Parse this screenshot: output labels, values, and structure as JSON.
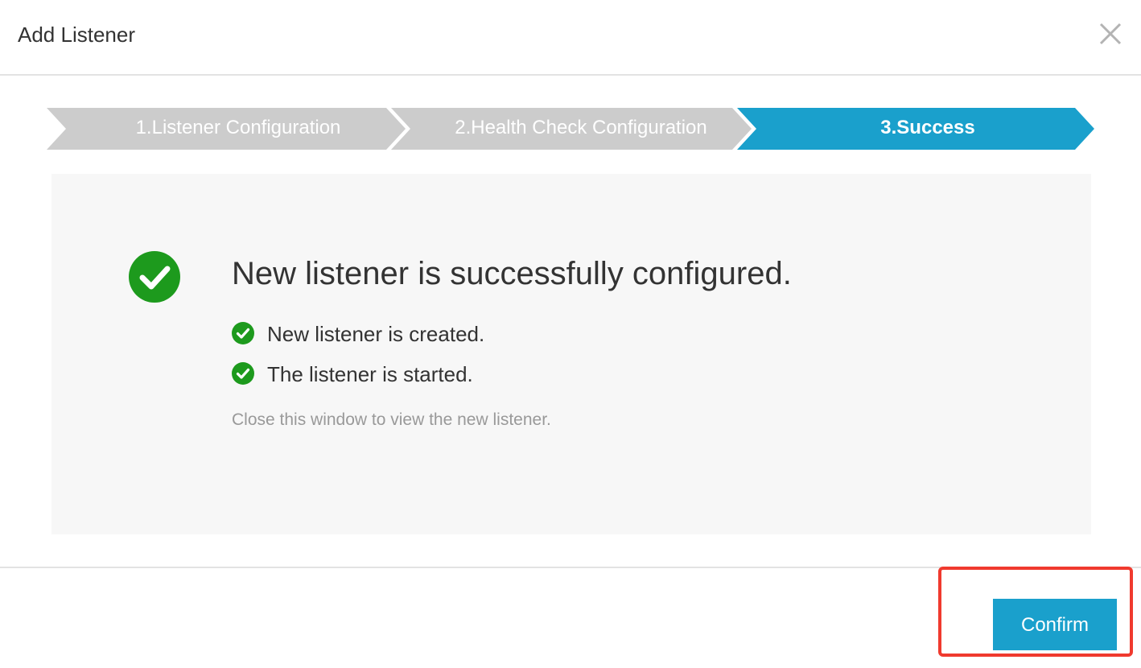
{
  "dialog": {
    "title": "Add Listener",
    "close_icon": "close-icon"
  },
  "steps": [
    {
      "label": "1.Listener Configuration",
      "state": "done",
      "color": "#cccccc"
    },
    {
      "label": "2.Health Check Configuration",
      "state": "done",
      "color": "#cccccc"
    },
    {
      "label": "3.Success",
      "state": "active",
      "color": "#1aa0cc"
    }
  ],
  "result": {
    "headline": "New listener is successfully configured.",
    "items": [
      {
        "text": "New listener is created.",
        "icon": "check-circle-icon"
      },
      {
        "text": "The listener is started.",
        "icon": "check-circle-icon"
      }
    ],
    "note": "Close this window to view the new listener.",
    "success_color": "#1d9a1d"
  },
  "footer": {
    "confirm_label": "Confirm",
    "accent_color": "#1aa0cc",
    "highlight_color": "#f03a2e"
  }
}
